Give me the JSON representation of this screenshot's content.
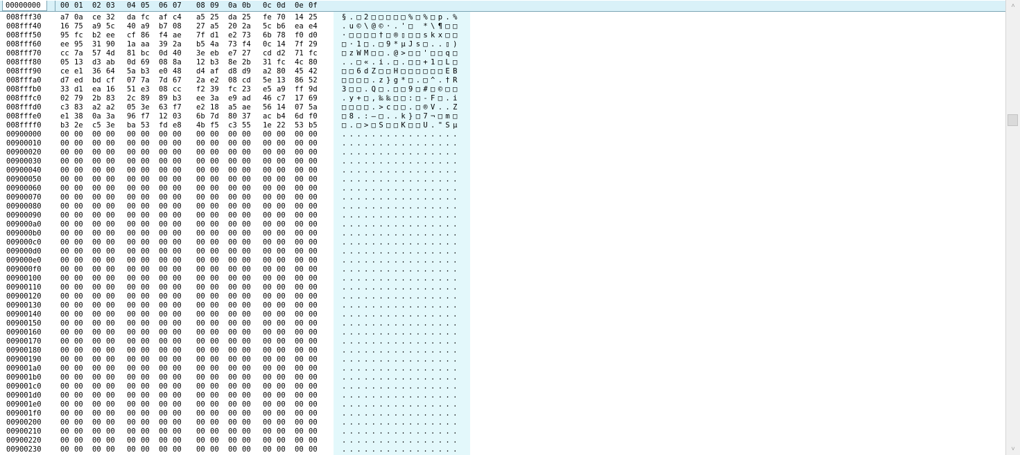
{
  "header": {
    "offset_label": "00000000",
    "columns": [
      "00",
      "01",
      "02",
      "03",
      "04",
      "05",
      "06",
      "07",
      "08",
      "09",
      "0a",
      "0b",
      "0c",
      "0d",
      "0e",
      "0f"
    ]
  },
  "scrollbar": {
    "up_glyph": "˄",
    "down_glyph": "˅"
  },
  "rows": [
    {
      "offset": "008fff30",
      "hex": [
        "a7",
        "0a",
        "ce",
        "32",
        "da",
        "fc",
        "af",
        "c4",
        "a5",
        "25",
        "da",
        "25",
        "fe",
        "70",
        "14",
        "25"
      ],
      "ascii": "§.□2□□□□□%□%□p.%"
    },
    {
      "offset": "008fff40",
      "hex": [
        "16",
        "75",
        "a9",
        "5c",
        "40",
        "a9",
        "b7",
        "08",
        "27",
        "a5",
        "20",
        "2a",
        "5c",
        "b6",
        "ea",
        "e4"
      ],
      "ascii": ".u©\\@©·.'□ *\\¶□□"
    },
    {
      "offset": "008fff50",
      "hex": [
        "95",
        "fc",
        "b2",
        "ee",
        "cf",
        "86",
        "f4",
        "ae",
        "7f",
        "d1",
        "e2",
        "73",
        "6b",
        "78",
        "f0",
        "d0"
      ],
      "ascii": "·□□□□†□®▯□□skx□□"
    },
    {
      "offset": "008fff60",
      "hex": [
        "ee",
        "95",
        "31",
        "90",
        "1a",
        "aa",
        "39",
        "2a",
        "b5",
        "4a",
        "73",
        "f4",
        "0c",
        "14",
        "7f",
        "29"
      ],
      "ascii": "□·1□.□9*µJs□..▯)"
    },
    {
      "offset": "008fff70",
      "hex": [
        "cc",
        "7a",
        "57",
        "4d",
        "81",
        "bc",
        "0d",
        "40",
        "3e",
        "eb",
        "e7",
        "27",
        "cd",
        "d2",
        "71",
        "fc"
      ],
      "ascii": "□zWM□□.@>□□'□□q□"
    },
    {
      "offset": "008fff80",
      "hex": [
        "05",
        "13",
        "d3",
        "ab",
        "0d",
        "69",
        "08",
        "8a",
        "12",
        "b3",
        "8e",
        "2b",
        "31",
        "fc",
        "4c",
        "80"
      ],
      "ascii": "..□«.i.□.□□+1□L□"
    },
    {
      "offset": "008fff90",
      "hex": [
        "ce",
        "e1",
        "36",
        "64",
        "5a",
        "b3",
        "e0",
        "48",
        "d4",
        "af",
        "d8",
        "d9",
        "a2",
        "80",
        "45",
        "42"
      ],
      "ascii": "□□6dZ□□H□□□□□□EB"
    },
    {
      "offset": "008fffa0",
      "hex": [
        "d7",
        "ed",
        "bd",
        "cf",
        "07",
        "7a",
        "7d",
        "67",
        "2a",
        "e2",
        "08",
        "cd",
        "5e",
        "13",
        "86",
        "52"
      ],
      "ascii": "□□□□.z}g*□.□^.†R"
    },
    {
      "offset": "008fffb0",
      "hex": [
        "33",
        "d1",
        "ea",
        "16",
        "51",
        "e3",
        "08",
        "cc",
        "f2",
        "39",
        "fc",
        "23",
        "e5",
        "a9",
        "ff",
        "9d"
      ],
      "ascii": "3□□.Q□.□□9□#□©□□"
    },
    {
      "offset": "008fffc0",
      "hex": [
        "02",
        "79",
        "2b",
        "83",
        "2c",
        "89",
        "89",
        "b3",
        "ee",
        "3a",
        "e9",
        "ad",
        "46",
        "c7",
        "17",
        "69"
      ],
      "ascii": ".y+□,‰‰□□:□-F□.i"
    },
    {
      "offset": "008fffd0",
      "hex": [
        "c3",
        "83",
        "a2",
        "a2",
        "05",
        "3e",
        "63",
        "f7",
        "e2",
        "18",
        "a5",
        "ae",
        "56",
        "14",
        "07",
        "5a"
      ],
      "ascii": "□□□□.>c□□.□®V..Z"
    },
    {
      "offset": "008fffe0",
      "hex": [
        "e1",
        "38",
        "0a",
        "3a",
        "96",
        "f7",
        "12",
        "03",
        "6b",
        "7d",
        "80",
        "37",
        "ac",
        "b4",
        "6d",
        "f0"
      ],
      "ascii": "□8.:–□..k}□7¬□m□"
    },
    {
      "offset": "008ffff0",
      "hex": [
        "b3",
        "2e",
        "c5",
        "3e",
        "ba",
        "53",
        "fd",
        "e8",
        "4b",
        "f5",
        "c3",
        "55",
        "1e",
        "22",
        "53",
        "b5"
      ],
      "ascii": "□.□>□S□□K□□U.\"Sµ"
    },
    {
      "offset": "00900000",
      "hex": [
        "00",
        "00",
        "00",
        "00",
        "00",
        "00",
        "00",
        "00",
        "00",
        "00",
        "00",
        "00",
        "00",
        "00",
        "00",
        "00"
      ],
      "ascii": "................"
    },
    {
      "offset": "00900010",
      "hex": [
        "00",
        "00",
        "00",
        "00",
        "00",
        "00",
        "00",
        "00",
        "00",
        "00",
        "00",
        "00",
        "00",
        "00",
        "00",
        "00"
      ],
      "ascii": "................"
    },
    {
      "offset": "00900020",
      "hex": [
        "00",
        "00",
        "00",
        "00",
        "00",
        "00",
        "00",
        "00",
        "00",
        "00",
        "00",
        "00",
        "00",
        "00",
        "00",
        "00"
      ],
      "ascii": "................"
    },
    {
      "offset": "00900030",
      "hex": [
        "00",
        "00",
        "00",
        "00",
        "00",
        "00",
        "00",
        "00",
        "00",
        "00",
        "00",
        "00",
        "00",
        "00",
        "00",
        "00"
      ],
      "ascii": "................"
    },
    {
      "offset": "00900040",
      "hex": [
        "00",
        "00",
        "00",
        "00",
        "00",
        "00",
        "00",
        "00",
        "00",
        "00",
        "00",
        "00",
        "00",
        "00",
        "00",
        "00"
      ],
      "ascii": "................"
    },
    {
      "offset": "00900050",
      "hex": [
        "00",
        "00",
        "00",
        "00",
        "00",
        "00",
        "00",
        "00",
        "00",
        "00",
        "00",
        "00",
        "00",
        "00",
        "00",
        "00"
      ],
      "ascii": "................"
    },
    {
      "offset": "00900060",
      "hex": [
        "00",
        "00",
        "00",
        "00",
        "00",
        "00",
        "00",
        "00",
        "00",
        "00",
        "00",
        "00",
        "00",
        "00",
        "00",
        "00"
      ],
      "ascii": "................"
    },
    {
      "offset": "00900070",
      "hex": [
        "00",
        "00",
        "00",
        "00",
        "00",
        "00",
        "00",
        "00",
        "00",
        "00",
        "00",
        "00",
        "00",
        "00",
        "00",
        "00"
      ],
      "ascii": "................"
    },
    {
      "offset": "00900080",
      "hex": [
        "00",
        "00",
        "00",
        "00",
        "00",
        "00",
        "00",
        "00",
        "00",
        "00",
        "00",
        "00",
        "00",
        "00",
        "00",
        "00"
      ],
      "ascii": "................"
    },
    {
      "offset": "00900090",
      "hex": [
        "00",
        "00",
        "00",
        "00",
        "00",
        "00",
        "00",
        "00",
        "00",
        "00",
        "00",
        "00",
        "00",
        "00",
        "00",
        "00"
      ],
      "ascii": "................"
    },
    {
      "offset": "009000a0",
      "hex": [
        "00",
        "00",
        "00",
        "00",
        "00",
        "00",
        "00",
        "00",
        "00",
        "00",
        "00",
        "00",
        "00",
        "00",
        "00",
        "00"
      ],
      "ascii": "................"
    },
    {
      "offset": "009000b0",
      "hex": [
        "00",
        "00",
        "00",
        "00",
        "00",
        "00",
        "00",
        "00",
        "00",
        "00",
        "00",
        "00",
        "00",
        "00",
        "00",
        "00"
      ],
      "ascii": "................"
    },
    {
      "offset": "009000c0",
      "hex": [
        "00",
        "00",
        "00",
        "00",
        "00",
        "00",
        "00",
        "00",
        "00",
        "00",
        "00",
        "00",
        "00",
        "00",
        "00",
        "00"
      ],
      "ascii": "................"
    },
    {
      "offset": "009000d0",
      "hex": [
        "00",
        "00",
        "00",
        "00",
        "00",
        "00",
        "00",
        "00",
        "00",
        "00",
        "00",
        "00",
        "00",
        "00",
        "00",
        "00"
      ],
      "ascii": "................"
    },
    {
      "offset": "009000e0",
      "hex": [
        "00",
        "00",
        "00",
        "00",
        "00",
        "00",
        "00",
        "00",
        "00",
        "00",
        "00",
        "00",
        "00",
        "00",
        "00",
        "00"
      ],
      "ascii": "................"
    },
    {
      "offset": "009000f0",
      "hex": [
        "00",
        "00",
        "00",
        "00",
        "00",
        "00",
        "00",
        "00",
        "00",
        "00",
        "00",
        "00",
        "00",
        "00",
        "00",
        "00"
      ],
      "ascii": "................"
    },
    {
      "offset": "00900100",
      "hex": [
        "00",
        "00",
        "00",
        "00",
        "00",
        "00",
        "00",
        "00",
        "00",
        "00",
        "00",
        "00",
        "00",
        "00",
        "00",
        "00"
      ],
      "ascii": "................"
    },
    {
      "offset": "00900110",
      "hex": [
        "00",
        "00",
        "00",
        "00",
        "00",
        "00",
        "00",
        "00",
        "00",
        "00",
        "00",
        "00",
        "00",
        "00",
        "00",
        "00"
      ],
      "ascii": "................"
    },
    {
      "offset": "00900120",
      "hex": [
        "00",
        "00",
        "00",
        "00",
        "00",
        "00",
        "00",
        "00",
        "00",
        "00",
        "00",
        "00",
        "00",
        "00",
        "00",
        "00"
      ],
      "ascii": "................"
    },
    {
      "offset": "00900130",
      "hex": [
        "00",
        "00",
        "00",
        "00",
        "00",
        "00",
        "00",
        "00",
        "00",
        "00",
        "00",
        "00",
        "00",
        "00",
        "00",
        "00"
      ],
      "ascii": "................"
    },
    {
      "offset": "00900140",
      "hex": [
        "00",
        "00",
        "00",
        "00",
        "00",
        "00",
        "00",
        "00",
        "00",
        "00",
        "00",
        "00",
        "00",
        "00",
        "00",
        "00"
      ],
      "ascii": "................"
    },
    {
      "offset": "00900150",
      "hex": [
        "00",
        "00",
        "00",
        "00",
        "00",
        "00",
        "00",
        "00",
        "00",
        "00",
        "00",
        "00",
        "00",
        "00",
        "00",
        "00"
      ],
      "ascii": "................"
    },
    {
      "offset": "00900160",
      "hex": [
        "00",
        "00",
        "00",
        "00",
        "00",
        "00",
        "00",
        "00",
        "00",
        "00",
        "00",
        "00",
        "00",
        "00",
        "00",
        "00"
      ],
      "ascii": "................"
    },
    {
      "offset": "00900170",
      "hex": [
        "00",
        "00",
        "00",
        "00",
        "00",
        "00",
        "00",
        "00",
        "00",
        "00",
        "00",
        "00",
        "00",
        "00",
        "00",
        "00"
      ],
      "ascii": "................"
    },
    {
      "offset": "00900180",
      "hex": [
        "00",
        "00",
        "00",
        "00",
        "00",
        "00",
        "00",
        "00",
        "00",
        "00",
        "00",
        "00",
        "00",
        "00",
        "00",
        "00"
      ],
      "ascii": "................"
    },
    {
      "offset": "00900190",
      "hex": [
        "00",
        "00",
        "00",
        "00",
        "00",
        "00",
        "00",
        "00",
        "00",
        "00",
        "00",
        "00",
        "00",
        "00",
        "00",
        "00"
      ],
      "ascii": "................"
    },
    {
      "offset": "009001a0",
      "hex": [
        "00",
        "00",
        "00",
        "00",
        "00",
        "00",
        "00",
        "00",
        "00",
        "00",
        "00",
        "00",
        "00",
        "00",
        "00",
        "00"
      ],
      "ascii": "................"
    },
    {
      "offset": "009001b0",
      "hex": [
        "00",
        "00",
        "00",
        "00",
        "00",
        "00",
        "00",
        "00",
        "00",
        "00",
        "00",
        "00",
        "00",
        "00",
        "00",
        "00"
      ],
      "ascii": "................"
    },
    {
      "offset": "009001c0",
      "hex": [
        "00",
        "00",
        "00",
        "00",
        "00",
        "00",
        "00",
        "00",
        "00",
        "00",
        "00",
        "00",
        "00",
        "00",
        "00",
        "00"
      ],
      "ascii": "................"
    },
    {
      "offset": "009001d0",
      "hex": [
        "00",
        "00",
        "00",
        "00",
        "00",
        "00",
        "00",
        "00",
        "00",
        "00",
        "00",
        "00",
        "00",
        "00",
        "00",
        "00"
      ],
      "ascii": "................"
    },
    {
      "offset": "009001e0",
      "hex": [
        "00",
        "00",
        "00",
        "00",
        "00",
        "00",
        "00",
        "00",
        "00",
        "00",
        "00",
        "00",
        "00",
        "00",
        "00",
        "00"
      ],
      "ascii": "................"
    },
    {
      "offset": "009001f0",
      "hex": [
        "00",
        "00",
        "00",
        "00",
        "00",
        "00",
        "00",
        "00",
        "00",
        "00",
        "00",
        "00",
        "00",
        "00",
        "00",
        "00"
      ],
      "ascii": "................"
    },
    {
      "offset": "00900200",
      "hex": [
        "00",
        "00",
        "00",
        "00",
        "00",
        "00",
        "00",
        "00",
        "00",
        "00",
        "00",
        "00",
        "00",
        "00",
        "00",
        "00"
      ],
      "ascii": "................"
    },
    {
      "offset": "00900210",
      "hex": [
        "00",
        "00",
        "00",
        "00",
        "00",
        "00",
        "00",
        "00",
        "00",
        "00",
        "00",
        "00",
        "00",
        "00",
        "00",
        "00"
      ],
      "ascii": "................"
    },
    {
      "offset": "00900220",
      "hex": [
        "00",
        "00",
        "00",
        "00",
        "00",
        "00",
        "00",
        "00",
        "00",
        "00",
        "00",
        "00",
        "00",
        "00",
        "00",
        "00"
      ],
      "ascii": "................"
    },
    {
      "offset": "00900230",
      "hex": [
        "00",
        "00",
        "00",
        "00",
        "00",
        "00",
        "00",
        "00",
        "00",
        "00",
        "00",
        "00",
        "00",
        "00",
        "00",
        "00"
      ],
      "ascii": "................"
    }
  ]
}
